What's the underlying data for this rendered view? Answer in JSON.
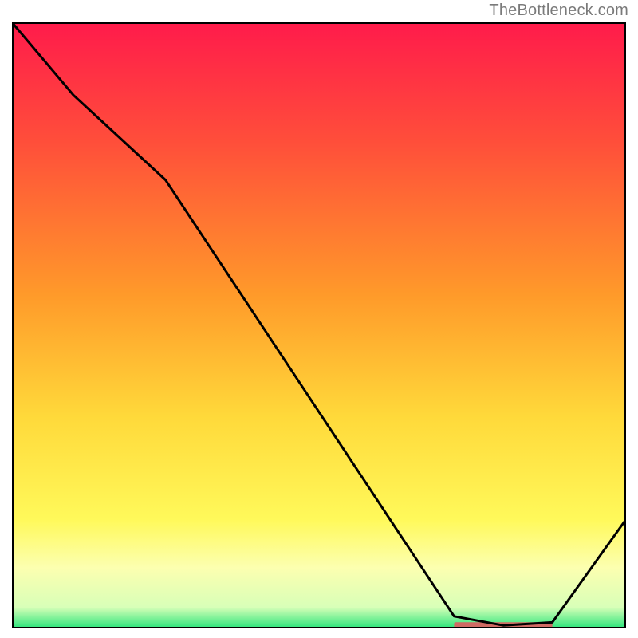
{
  "watermark": "TheBottleneck.com",
  "chart_data": {
    "type": "line",
    "title": "",
    "xlabel": "",
    "ylabel": "",
    "xlim": [
      0,
      100
    ],
    "ylim": [
      0,
      100
    ],
    "series": [
      {
        "name": "curve",
        "x": [
          0,
          10,
          25,
          72,
          80,
          88,
          100
        ],
        "y": [
          100,
          88,
          74,
          2,
          0.5,
          1,
          18
        ]
      }
    ],
    "marker_bar": {
      "x_start": 72,
      "x_end": 88,
      "y": 0.5
    },
    "gradient_stops": [
      {
        "offset": 0.0,
        "color": "#ff1b4b"
      },
      {
        "offset": 0.2,
        "color": "#ff4f3a"
      },
      {
        "offset": 0.45,
        "color": "#ff9a2a"
      },
      {
        "offset": 0.65,
        "color": "#ffd93a"
      },
      {
        "offset": 0.82,
        "color": "#fff95a"
      },
      {
        "offset": 0.9,
        "color": "#fcffb0"
      },
      {
        "offset": 0.965,
        "color": "#d8ffb8"
      },
      {
        "offset": 1.0,
        "color": "#28e57a"
      }
    ],
    "colors": {
      "border": "#000000",
      "line": "#000000",
      "marker": "#cf6a63"
    }
  }
}
